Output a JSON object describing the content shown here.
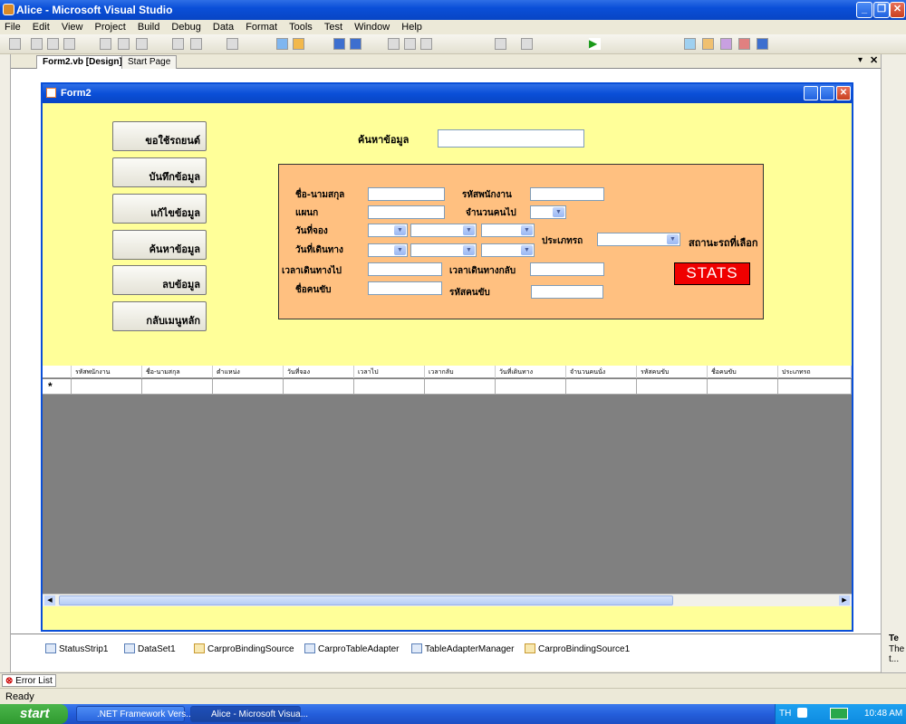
{
  "window": {
    "title": "Alice - Microsoft Visual Studio"
  },
  "menubar": [
    "File",
    "Edit",
    "View",
    "Project",
    "Build",
    "Debug",
    "Data",
    "Format",
    "Tools",
    "Test",
    "Window",
    "Help"
  ],
  "doc_tabs": [
    {
      "label": "Form2.vb [Design]*"
    },
    {
      "label": "Start Page"
    }
  ],
  "form": {
    "title": "Form2",
    "buttons": [
      "ขอใช้รถยนต์",
      "บันทึกข้อมูล",
      "แก้ไขข้อมูล",
      "ค้นหาข้อมูล",
      "ลบข้อมูล",
      "กลับเมนูหลัก"
    ],
    "search_label": "ค้นหาข้อมูล",
    "search_value": "",
    "panel": {
      "name_label": "ชื่อ-นามสกุล",
      "emp_id_label": "รหัสพนักงาน",
      "dept_label": "แผนก",
      "passengers_label": "จำนวนคนไป",
      "booking_date_label": "วันที่จอง",
      "travel_date_label": "วันที่เดินทาง",
      "car_type_label": "ประเภทรถ",
      "car_status_label": "สถานะรถที่เลือก",
      "depart_time_label": "เวลาเดินทางไป",
      "return_time_label": "เวลาเดินทางกลับ",
      "driver_name_label": "ชื่อคนขับ",
      "driver_id_label": "รหัสคนขับ",
      "stats_label": "STATS"
    },
    "grid": {
      "columns": [
        "รหัสพนักงาน",
        "ชื่อ-นามสกุล",
        "ตำแหน่ง",
        "วันที่จอง",
        "เวลาไป",
        "เวลากลับ",
        "วันที่เดินทาง",
        "จำนวนคนนั่ง",
        "รหัสคนขับ",
        "ชื่อคนขับ",
        "ประเภทรถ"
      ],
      "new_row_marker": "*"
    }
  },
  "components": [
    "StatusStrip1",
    "DataSet1",
    "CarproBindingSource",
    "CarproTableAdapter",
    "TableAdapterManager",
    "CarproBindingSource1"
  ],
  "error_list": "Error List",
  "status": "Ready",
  "taskbar": {
    "start": "start",
    "tasks": [
      ".NET Framework Vers...",
      "Alice - Microsoft Visua..."
    ],
    "lang": "TH",
    "clock": "10:48 AM"
  },
  "right_panel": {
    "item1": "Te",
    "item2": "The",
    "item3": "t..."
  }
}
